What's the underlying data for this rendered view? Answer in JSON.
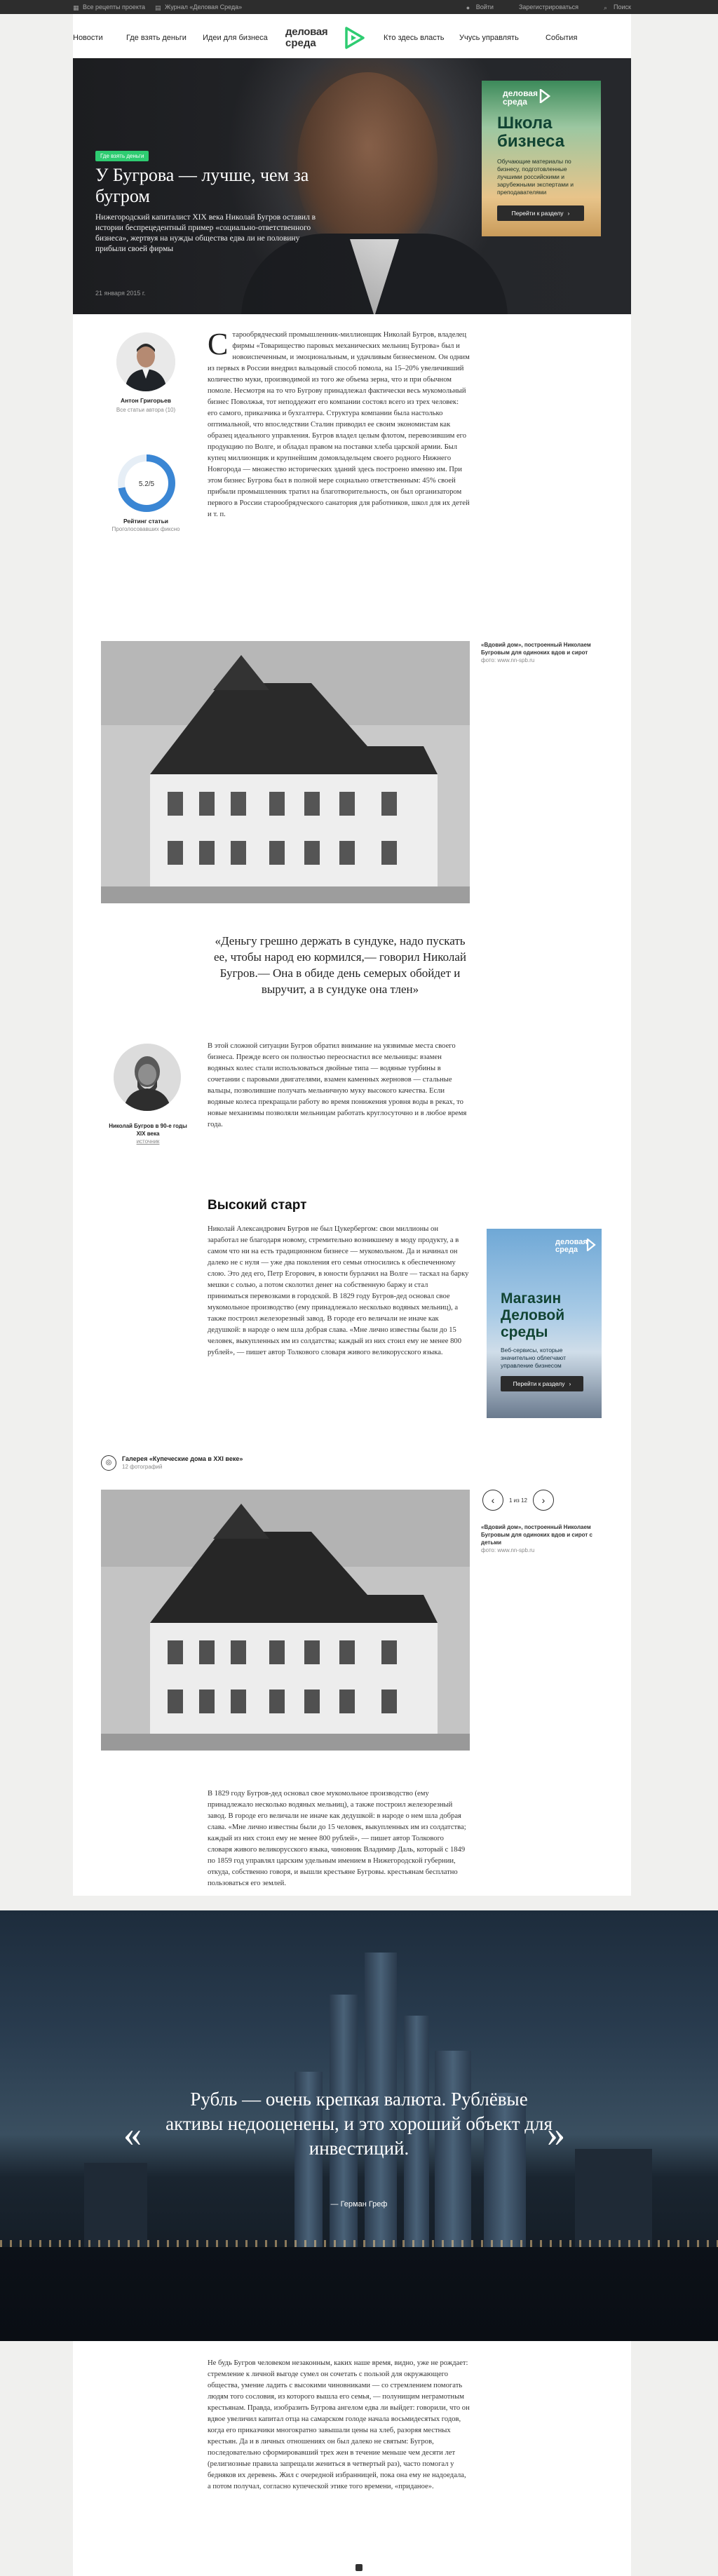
{
  "topbar": {
    "left_items": [
      "Все рецепты проекта",
      "Журнал «Деловая Среда»"
    ],
    "right_items": [
      "Войти",
      "Зарегистрироваться",
      "Поиск"
    ]
  },
  "nav": {
    "items": [
      "Новости",
      "Где взять деньги",
      "Идеи для бизнеса",
      "Кто здесь власть",
      "Учусь управлять",
      "События"
    ],
    "logo_line1": "деловая",
    "logo_line2": "среда"
  },
  "hero": {
    "tag": "Где взять деньги",
    "title": "У Бугрова — лучше, чем за бугром",
    "subtitle": "Нижегородский капиталист XIX века Николай Бугров оставил в истории беспрецедентный пример «социально-ответственного бизнеса», жертвуя на нужды общества едва ли не половину прибыли своей фирмы",
    "date": "21 января 2015 г.",
    "promo": {
      "logo_line1": "деловая",
      "logo_line2": "среда",
      "title": "Школа бизнеса",
      "text": "Обучающие материалы по бизнесу, подготовленные лучшими российскими и зарубежными экспертами и преподавателями",
      "button": "Перейти к разделу"
    }
  },
  "author": {
    "name": "Антон Григорьев",
    "sub": "Все статьи автора (10)"
  },
  "rating": {
    "value": "5.2/5",
    "fill": 0.72,
    "label": "Рейтинг статьи",
    "sub": "Проголосовавших фиксно"
  },
  "article": {
    "dropcap": "С",
    "intro": "тарообрядческий промышленник-миллионщик Николай Бугров, владелец фирмы «Товарищество паровых механических мельниц Бугрова» был и новоиспеченным, и эмоциональным, и удачливым бизнесменом. Он одним из первых в России внедрил вальцовый способ помола, на 15–20% увеличивший количество муки, производимой из того же объема зерна, что и при обычном помоле. Несмотря на то что Бугрову принадлежал фактически весь мукомольный бизнес Поволжья, тот неподдежит его компании состоял всего из трех человек: его самого, приказчика и бухгалтера. Структура компании была настолько оптимальной, что впоследствии Сталин приводил ее своим экономистам как образец идеального управления. Бугров владел целым флотом, перевозившим его продукцию по Волге, и обладал правом на поставки хлеба царской армии. Был купец миллионщик и крупнейшим домовладельцем своего родного Нижнего Новгорода — множество исторических зданий здесь построено именно им. При этом бизнес Бугрова был в полной мере социально ответственным: 45% своей прибыли промышленник тратил на благотворительность, он был организатором первого в России старообрядческого санатория для работников, школ для их детей и т. п.",
    "photo1_caption_bold": "«Вдовий дом», построенный Николаем Бугровым для одиноких вдов и сирот",
    "photo1_caption_src": "фото: www.nn-spb.ru",
    "quote": "«Деньгу грешно держать в сундуке, надо пускать ее, чтобы народ ею кормился,— говорил Николай Бугров.— Она в обиде день семерых обойдет и выручит, а в сундуке она тлен»",
    "portrait_caption": "Николай Бугров в 90-е годы XIX века",
    "portrait_link": "источник",
    "sec2": "В этой сложной ситуации Бугров обратил внимание на уязвимые места своего бизнеса. Прежде всего он полностью переоснастил все мельницы: взамен водяных колес стали использоваться двойные типа — водяные турбины в сочетании с паровыми двигателями, взамен каменных жерновов — стальные вальцы, позволившие получать мельничную муку высокого качества. Если водяные колеса прекращали работу во время понижения уровня воды в реках, то новые механизмы позволяли мельницам работать круглосуточно и в любое время года.",
    "h2": "Высокий старт",
    "sec3": "Николай Александрович Бугров не был Цукербергом: свои миллионы он заработал не благодаря новому, стремительно возникшему в моду продукту, а в самом что ни на есть традиционном бизнесе — мукомольном. Да и начинал он далеко не с нуля — уже два поколения его семьи относились к обеспеченному слою. Это дед его, Петр Егорович, в юности бурлачил на Волге — таскал на барку мешки с солью, а потом сколотил денег на собственную баржу и стал приниматься перевозками в городской. В 1829 году Бугров-дед основал свое мукомольное производство (ему принадлежало несколько водяных мельниц), а также построил железорезный завод. В городе его величали не иначе как дедушкой: в народе о нем шла добрая слава. «Мне лично известны были до 15 человек, выкупленных им из солдатства; каждый из них стоил ему не менее 800 рублей», — пишет автор Толкового словаря живого великорусского языка.",
    "gallery_title": "Галерея «Купеческие дома в XXI веке»",
    "gallery_count": "12 фотографий",
    "gallery_counter": "1 из 12",
    "photo2_caption_bold": "«Вдовий дом», построенный Николаем Бугровым для одиноких вдов и сирот с детьми",
    "photo2_caption_src": "фото: www.nn-spb.ru",
    "sec4": "В 1829 году Бугров-дед основал свое мукомольное производство (ему принадлежало несколько водяных мельниц), а также построил железорезный завод. В городе его величали не иначе как дедушкой: в народе о нем шла добрая слава. «Мне лично известны были до 15 человек, выкупленных им из солдатства; каждый из них стоил ему не менее 800 рублей», — пишет автор Толкового словаря живого великорусского языка, чиновник Владимир Даль, который с 1849 по 1859 год управлял царским удельным имением в Нижегородской губернии, откуда, собственно говоря, и вышли крестьяне Бугровы. крестьянам бесплатно пользоваться его землей.",
    "band_quote": "Рубль — очень крепкая валюта. Рублёвые активы недооценены, и это хороший объект для инвестиций.",
    "band_author": "— Герман Греф",
    "sec5": "Не будь Бугров человеком незаконным, каких наше время, видно, уже не рождает: стремление к личной выгоде сумел он сочетать с пользой для окружающего общества, умение ладить с высокими чиновниками — со стремлением помогать людям того сословия, из которого вышла его семья, — полунищим неграмотным крестьянам. Правда, изобразить Бугрова ангелом едва ли выйдет: говорили, что он вдвое увеличил капитал отца на самарском голоде начала восьмидесятых годов, когда его приказчики многократно завышали цены на хлеб, разоряя местных крестьян. Да и в личных отношениях он был далеко не святым: Бугров, последовательно сформировавший трех жен в течение меньше чем десяти лет (религиозные правила запрещали жениться в четвертый раз), часто помогал у бедняков их деревень. Жил с очередной избранницей, пока она ему не надоедала, а потом получал, согласно купеческой этике того времени, «приданое»."
  }
}
